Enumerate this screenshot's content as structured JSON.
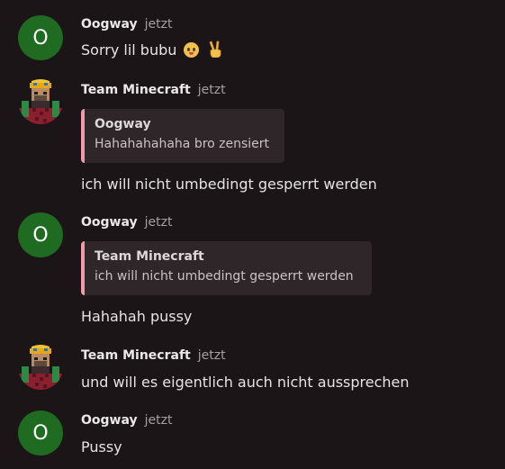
{
  "messages": [
    {
      "author": "Oogway",
      "time": "jetzt",
      "text": "Sorry lil bubu",
      "avatar_letter": "O",
      "emojis": [
        "pleading-face-icon",
        "victory-hand-icon"
      ]
    },
    {
      "author": "Team Minecraft",
      "time": "jetzt",
      "reply": {
        "author": "Oogway",
        "text": "Hahahahahaha bro zensiert"
      },
      "text": "ich will nicht umbedingt gesperrt werden"
    },
    {
      "author": "Oogway",
      "time": "jetzt",
      "avatar_letter": "O",
      "reply": {
        "author": "Team Minecraft",
        "text": "ich will nicht umbedingt gesperrt werden"
      },
      "text": "Hahahah pussy"
    },
    {
      "author": "Team Minecraft",
      "time": "jetzt",
      "text": "und will es eigentlich auch nicht aussprechen"
    },
    {
      "author": "Oogway",
      "time": "jetzt",
      "avatar_letter": "O",
      "text": "Pussy"
    }
  ],
  "colors": {
    "background": "#1b1517",
    "oogway_avatar": "#1f6b22",
    "quote_bar": "#ee9ca8",
    "quote_bg": "#2e2628"
  }
}
